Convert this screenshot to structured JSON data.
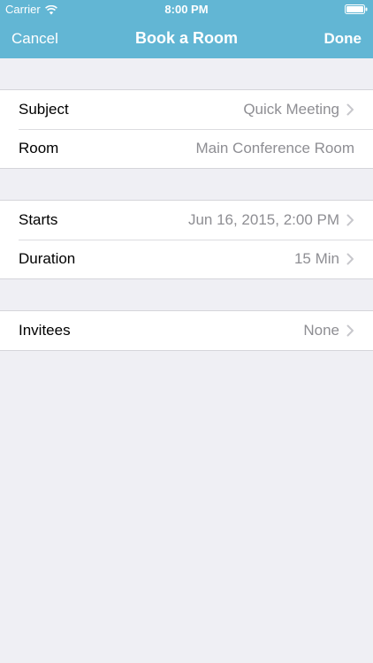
{
  "status_bar": {
    "carrier": "Carrier",
    "time": "8:00 PM"
  },
  "nav": {
    "title": "Book a Room",
    "left_label": "Cancel",
    "right_label": "Done",
    "bar_color": "#62b6d4"
  },
  "sections": [
    {
      "rows": [
        {
          "label": "Subject",
          "value": "Quick Meeting",
          "chevron": true
        },
        {
          "label": "Room",
          "value": "Main Conference Room",
          "chevron": false
        }
      ]
    },
    {
      "rows": [
        {
          "label": "Starts",
          "value": "Jun 16, 2015, 2:00 PM",
          "chevron": true
        },
        {
          "label": "Duration",
          "value": "15 Min",
          "chevron": true
        }
      ]
    },
    {
      "rows": [
        {
          "label": "Invitees",
          "value": "None",
          "chevron": true
        }
      ]
    }
  ],
  "colors": {
    "background": "#efeff4",
    "value_text": "#8e8e93",
    "chevron": "#c7c7cc"
  }
}
